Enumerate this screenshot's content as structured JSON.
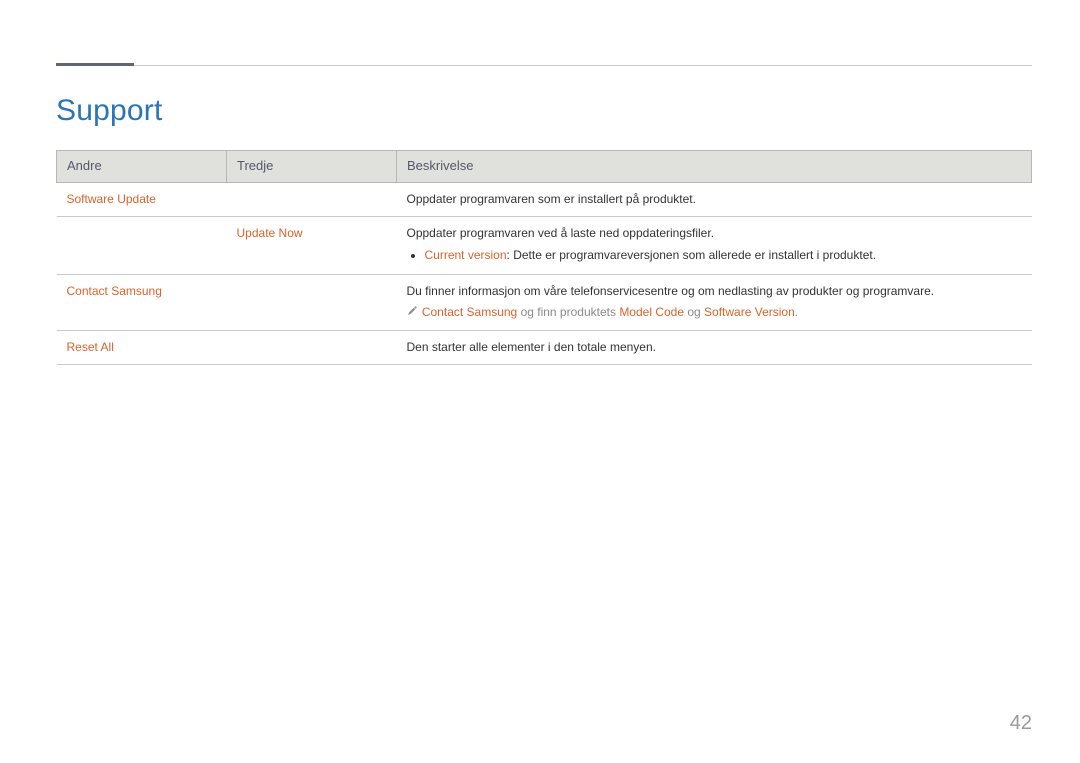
{
  "title": "Support",
  "headers": {
    "col1": "Andre",
    "col2": "Tredje",
    "col3": "Beskrivelse"
  },
  "rows": {
    "softwareUpdate": {
      "name": "Software Update",
      "desc": "Oppdater programvaren som er installert på produktet."
    },
    "updateNow": {
      "name": "Update Now",
      "descLine1": "Oppdater programvaren ved å laste ned oppdateringsfiler.",
      "bulletPrefix": "Current version",
      "bulletRest": ": Dette er programvareversjonen som allerede er installert i produktet."
    },
    "contactSamsung": {
      "name": "Contact Samsung",
      "descLine1": "Du finner informasjon om våre telefonservicesentre og om nedlasting av produkter og programvare.",
      "notePart1": "Contact Samsung",
      "notePart2": " og finn produktets ",
      "notePart3": "Model Code",
      "notePart4": " og ",
      "notePart5": "Software Version",
      "notePart6": "."
    },
    "resetAll": {
      "name": "Reset All",
      "desc": "Den starter alle elementer i den totale menyen."
    }
  },
  "pageNumber": "42"
}
